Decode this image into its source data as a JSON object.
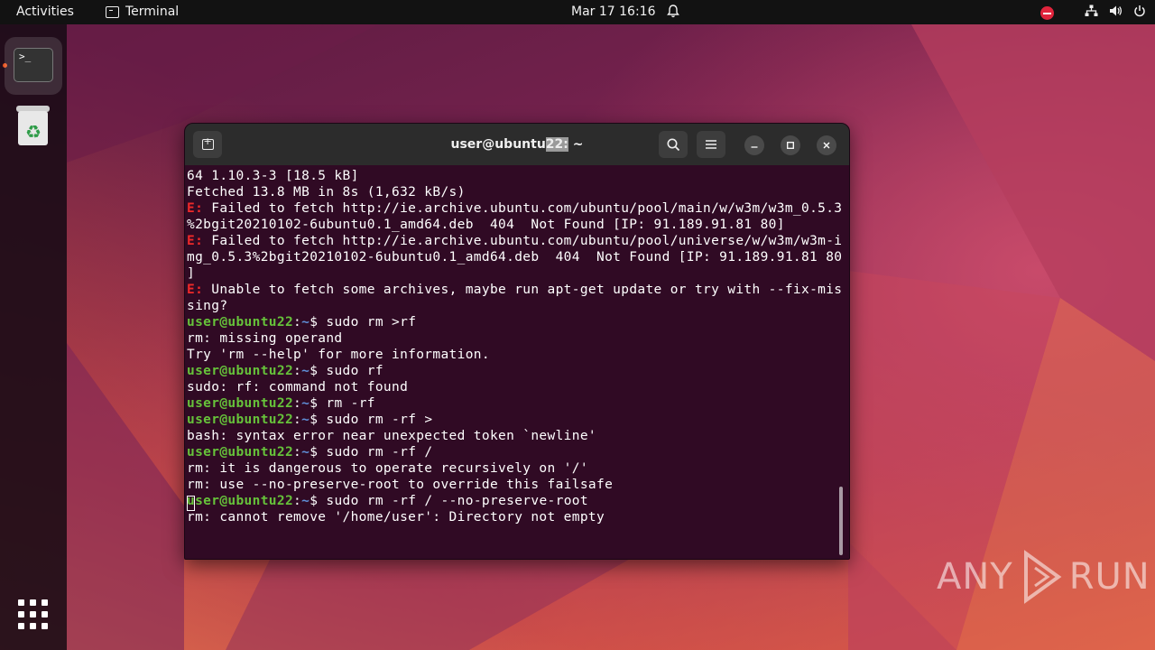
{
  "topbar": {
    "activities": "Activities",
    "app_name": "Terminal",
    "clock": "Mar 17  16:16",
    "icons": [
      "bell-icon",
      "dnd-icon",
      "network-icon",
      "volume-icon",
      "power-icon"
    ]
  },
  "dock": {
    "items": [
      "terminal",
      "trash",
      "show-applications"
    ]
  },
  "window": {
    "title_pre": "user@ubuntu",
    "title_hl": "22:",
    "title_post": " ~"
  },
  "terminal": {
    "lines": [
      {
        "text": "64 1.10.3-3 [18.5 kB]"
      },
      {
        "text": "Fetched 13.8 MB in 8s (1,632 kB/s)"
      },
      {
        "err": "E:",
        "text": " Failed to fetch http://ie.archive.ubuntu.com/ubuntu/pool/main/w/w3m/w3m_0.5.3"
      },
      {
        "text": "%2bgit20210102-6ubuntu0.1_amd64.deb  404  Not Found [IP: 91.189.91.81 80]"
      },
      {
        "err": "E:",
        "text": " Failed to fetch http://ie.archive.ubuntu.com/ubuntu/pool/universe/w/w3m/w3m-i"
      },
      {
        "text": "mg_0.5.3%2bgit20210102-6ubuntu0.1_amd64.deb  404  Not Found [IP: 91.189.91.81 80"
      },
      {
        "text": "]"
      },
      {
        "err": "E:",
        "text": " Unable to fetch some archives, maybe run apt-get update or try with --fix-mis"
      },
      {
        "text": "sing?"
      },
      {
        "prompt": "user@ubuntu22",
        "cmd": "$ sudo rm >rf"
      },
      {
        "text": "rm: missing operand"
      },
      {
        "text": "Try 'rm --help' for more information."
      },
      {
        "prompt": "user@ubuntu22",
        "cmd": "$ sudo rf"
      },
      {
        "text": "sudo: rf: command not found"
      },
      {
        "prompt": "user@ubuntu22",
        "cmd": "$ rm -rf"
      },
      {
        "prompt": "user@ubuntu22",
        "cmd": "$ sudo rm -rf >"
      },
      {
        "text": "bash: syntax error near unexpected token `newline'"
      },
      {
        "prompt": "user@ubuntu22",
        "cmd": "$ sudo rm -rf /"
      },
      {
        "text": "rm: it is dangerous to operate recursively on '/'"
      },
      {
        "text": "rm: use --no-preserve-root to override this failsafe"
      },
      {
        "prompt": "user@ubuntu22",
        "cmd": "$ sudo rm -rf / --no-preserve-root"
      },
      {
        "text": "rm: cannot remove '/home/user': Directory not empty"
      }
    ],
    "prompt_sep": ":",
    "prompt_dir": "~"
  },
  "watermark": {
    "left": "ANY",
    "right": "RUN"
  },
  "colors": {
    "terminal_bg": "#300a24",
    "error": "#ef2929",
    "prompt": "#66c23a",
    "dir": "#5f8fd8",
    "accent": "#e95420"
  }
}
